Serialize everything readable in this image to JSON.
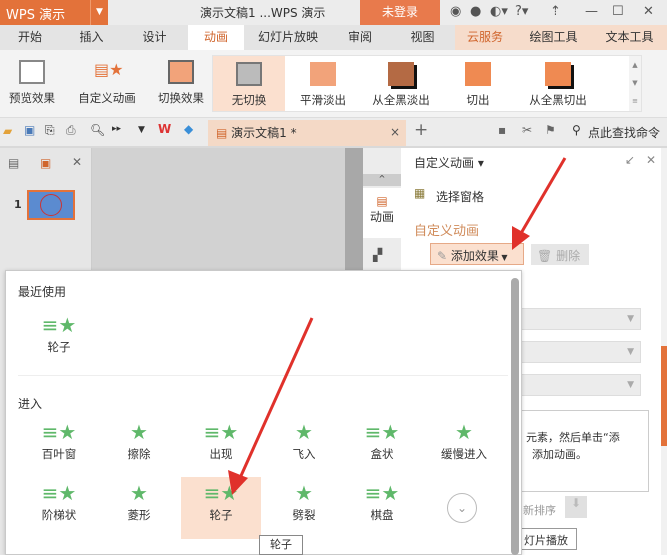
{
  "app": {
    "logo": "WPS 演示",
    "title": "演示文稿1 ...WPS 演示",
    "login": "未登录"
  },
  "tabs": [
    "开始",
    "插入",
    "设计",
    "动画",
    "幻灯片放映",
    "审阅",
    "视图",
    "云服务",
    "绘图工具",
    "文本工具"
  ],
  "ribbon": {
    "preview": "预览效果",
    "custom": "自定义动画",
    "switch": "切换效果",
    "gallery": [
      "无切换",
      "平滑淡出",
      "从全黑淡出",
      "切出",
      "从全黑切出"
    ]
  },
  "toolbar": {
    "doc_tab": "演示文稿1 *",
    "search": "点此查找命令"
  },
  "leftpanel": {
    "slide_number": "1"
  },
  "sidetabs": {
    "animation": "动画"
  },
  "pane": {
    "header": "自定义动画",
    "select_pane": "选择窗格",
    "section": "自定义动画",
    "add_effect": "添加效果",
    "delete": "删除",
    "hint_line1": "元素，然后单击“添",
    "hint_line2": "添加动画。",
    "reorder": "新排序",
    "play": "灯片播放"
  },
  "popup": {
    "recent_title": "最近使用",
    "recent": [
      "轮子"
    ],
    "enter_title": "进入",
    "enter": [
      "百叶窗",
      "擦除",
      "出现",
      "飞入",
      "盒状",
      "缓慢进入",
      "阶梯状",
      "菱形",
      "轮子",
      "劈裂",
      "棋盘"
    ],
    "tooltip": "轮子"
  },
  "colors": {
    "accent": "#e3723a",
    "arrow": "#e0312b",
    "star": "#5fb86a"
  }
}
